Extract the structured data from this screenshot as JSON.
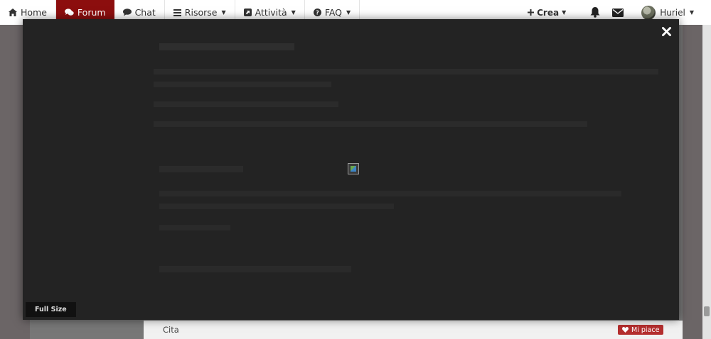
{
  "nav": {
    "items": [
      {
        "label": "Home",
        "icon": "home-icon",
        "active": false
      },
      {
        "label": "Forum",
        "icon": "comments-icon",
        "active": true
      },
      {
        "label": "Chat",
        "icon": "comment-icon",
        "active": false
      },
      {
        "label": "Risorse",
        "icon": "bars-icon",
        "active": false,
        "dropdown": true
      },
      {
        "label": "Attività",
        "icon": "external-square-icon",
        "active": false,
        "dropdown": true
      },
      {
        "label": "FAQ",
        "icon": "question-circle-icon",
        "active": false,
        "dropdown": true
      }
    ],
    "create_label": "Crea",
    "user_name": "Huriel"
  },
  "page": {
    "quote_label": "Cita",
    "like_label": "Mi piace"
  },
  "lightbox": {
    "full_size_label": "Full Size"
  },
  "colors": {
    "brand_red": "#8c0e0e",
    "lightbox_bg": "#232323",
    "like_red": "#b42e2e"
  }
}
